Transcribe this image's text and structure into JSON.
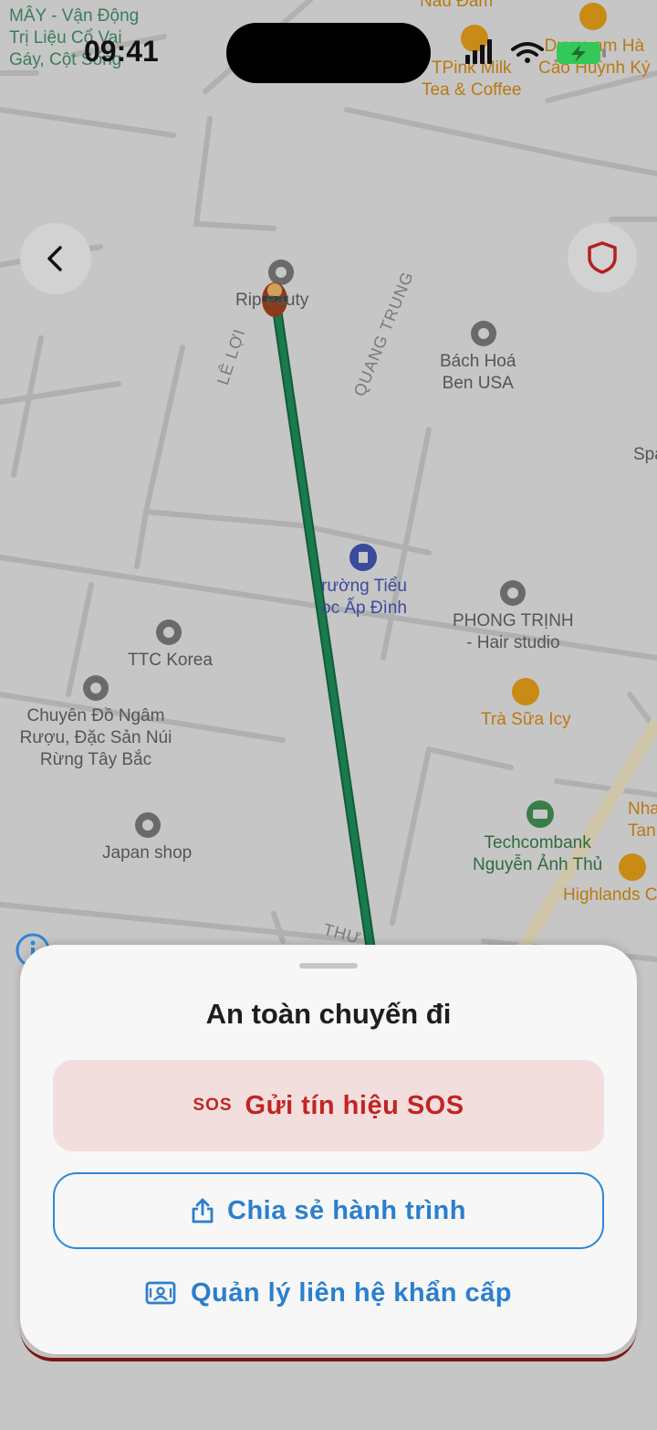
{
  "status_bar": {
    "time": "09:41"
  },
  "map": {
    "pois": [
      {
        "id": "may",
        "lines": [
          "MÂY - Vận Động",
          "Trị Liệu Cổ Vai",
          "Gáy, Cột Sống"
        ],
        "color": "green"
      },
      {
        "id": "nau-dam",
        "lines": [
          "Nâu Đâm"
        ],
        "color": "orange"
      },
      {
        "id": "tpink",
        "lines": [
          "TPink Milk",
          "Tea & Coffee"
        ],
        "color": "orange"
      },
      {
        "id": "cao-huynh-ky",
        "lines": [
          "Dược ạm Hà",
          "Cảo Huỳnh Ký"
        ],
        "color": "orange"
      },
      {
        "id": "rip-beauty",
        "lines": [
          "Rip  eauty"
        ],
        "color": "gray"
      },
      {
        "id": "bach-hoa",
        "lines": [
          "Bách Hoá",
          "Ben USA"
        ],
        "color": "gray"
      },
      {
        "id": "spa",
        "lines": [
          "Spa"
        ],
        "color": "gray"
      },
      {
        "id": "truong-tieu",
        "lines": [
          "rường Tiểu",
          "ọc Ấp Đình"
        ],
        "color": "blue"
      },
      {
        "id": "phong-trinh",
        "lines": [
          "PHONG TRỊNH",
          "- Hair studio"
        ],
        "color": "gray"
      },
      {
        "id": "ttc-korea",
        "lines": [
          "TTC Korea"
        ],
        "color": "gray"
      },
      {
        "id": "chuyen-do",
        "lines": [
          "Chuyên Đồ Ngâm",
          "Rượu, Đặc Sản Núi",
          "Rừng Tây Bắc"
        ],
        "color": "gray"
      },
      {
        "id": "tra-sua",
        "lines": [
          "Trà Sữa Icy"
        ],
        "color": "orange"
      },
      {
        "id": "nha-tan",
        "lines": [
          "Nha",
          "Tan"
        ],
        "color": "orange"
      },
      {
        "id": "japan-shop",
        "lines": [
          "Japan shop"
        ],
        "color": "gray"
      },
      {
        "id": "techcombank",
        "lines": [
          "Techcombank",
          "Nguyễn Ảnh Thủ"
        ],
        "color": "dgreen"
      },
      {
        "id": "highlands",
        "lines": [
          "Highlands C"
        ],
        "color": "orange"
      }
    ],
    "streets": [
      "LÊ LỢI",
      "QUANG TRUNG",
      "THƯ"
    ]
  },
  "sheet": {
    "title": "An toàn chuyến đi",
    "sos_badge": "SOS",
    "sos_label": "Gửi tín hiệu SOS",
    "share_label": "Chia sẻ hành trình",
    "contacts_label": "Quản lý liên hệ khẩn cấp"
  },
  "colors": {
    "route": "#1a7a4c",
    "sos": "#c22424",
    "primary": "#2a7fcf"
  }
}
